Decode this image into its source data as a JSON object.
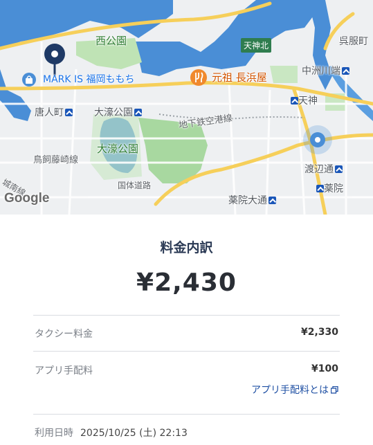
{
  "map": {
    "labels": {
      "nishi_koen": "西公園",
      "mark_is": "MARK IS 福岡ももち",
      "ganso": "元祖 長浜屋",
      "tenjin_kita": "天神北",
      "gofukumachi": "呉服町",
      "nakasu_kawabata": "中洲川端",
      "tenjin": "天神",
      "tojinmachi": "唐人町",
      "ohori_koen_station": "大濠公園",
      "chikatetsu_line": "地下鉄空港線",
      "ohori_koen_park": "大濠公園",
      "torikai_fujisaki": "鳥飼藤崎線",
      "watanabe_dori": "渡辺通",
      "yakuin": "薬院",
      "yakuin_odori": "薬院大通",
      "kokutai_doro": "国体道路",
      "jonan": "城南線"
    },
    "logo": "Google"
  },
  "summary": {
    "title": "料金内訳",
    "total": "¥2,430"
  },
  "breakdown": {
    "taxi_label": "タクシー料金",
    "taxi_value": "¥2,330",
    "app_fee_label": "アプリ手配料",
    "app_fee_value": "¥100",
    "app_fee_link": "アプリ手配料とは"
  },
  "usage": {
    "label": "利用日時",
    "datetime": "2025/10/25 (土) 22:13"
  },
  "colors": {
    "accent": "#1e4fa3",
    "title": "#2b3a55",
    "water": "#4a8ed6",
    "park": "#a8d8a0",
    "road_major": "#f6cf5a"
  }
}
